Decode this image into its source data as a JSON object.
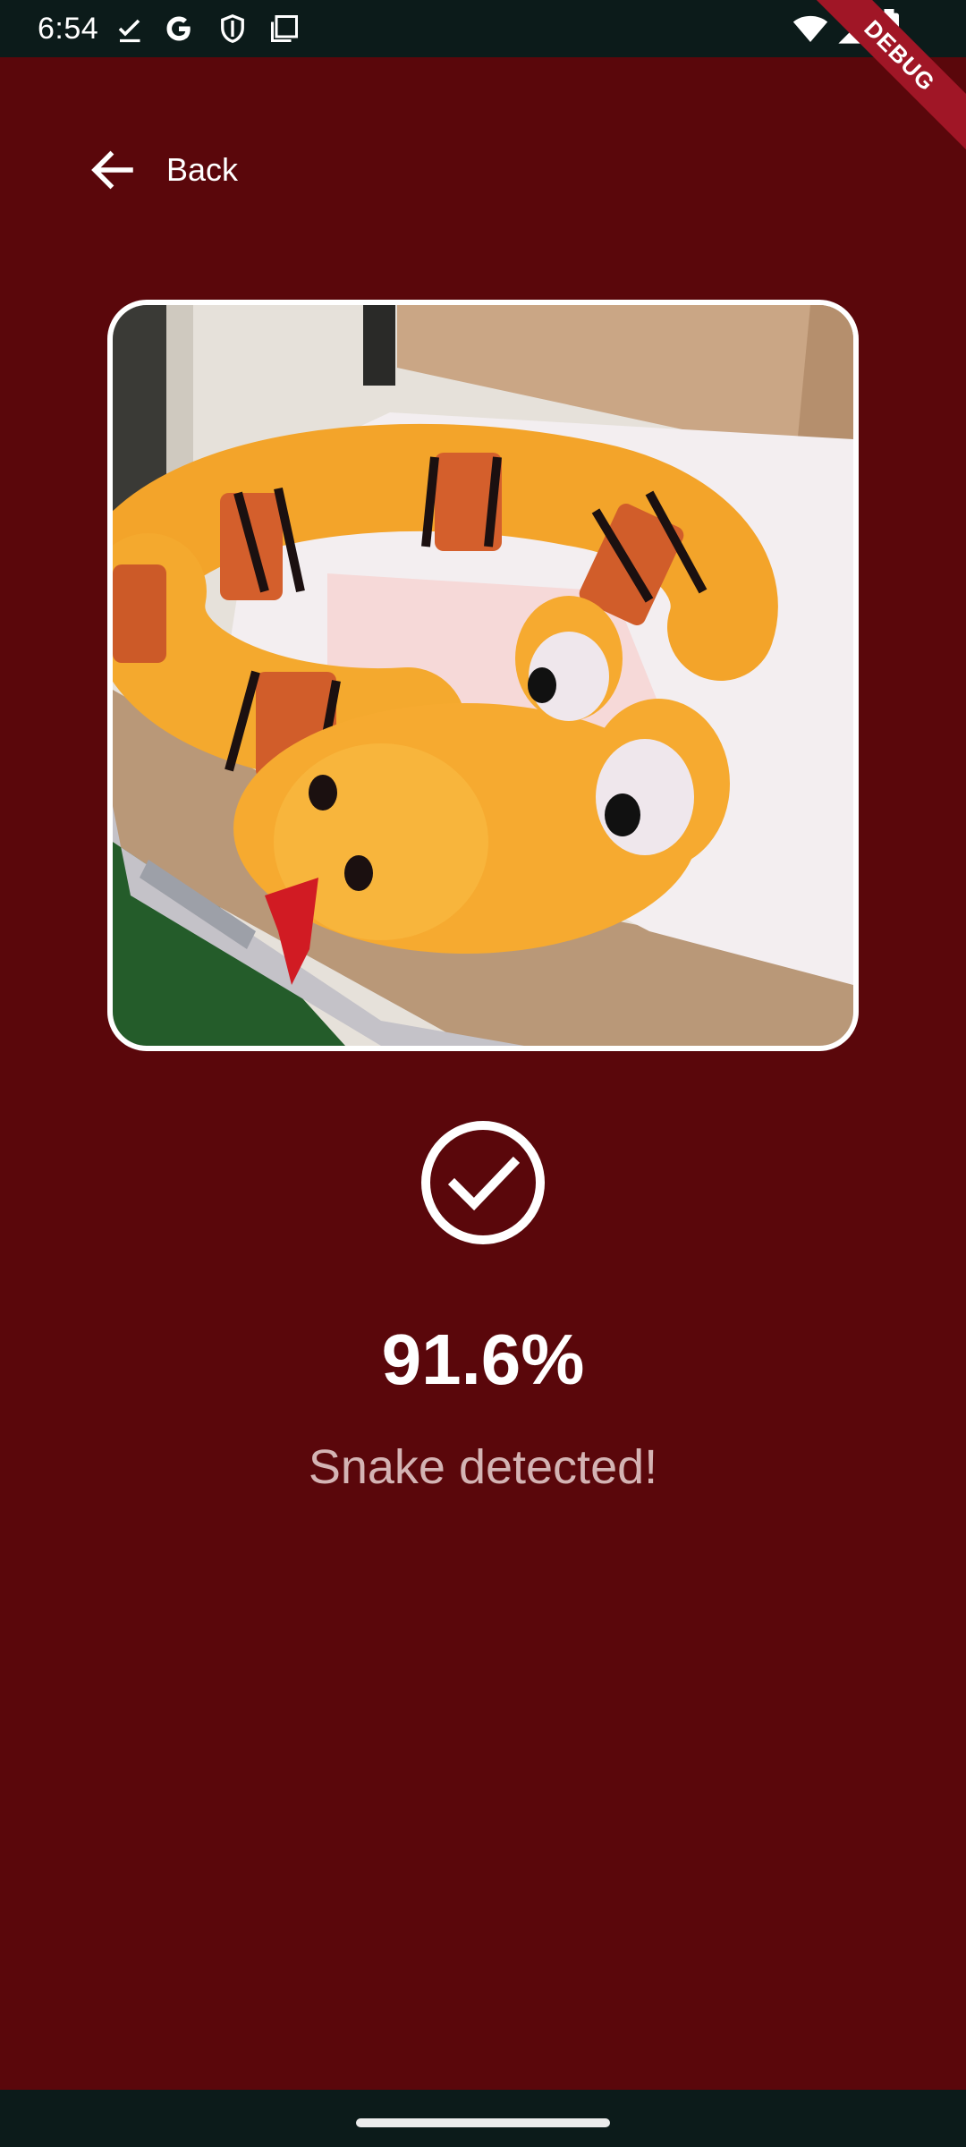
{
  "status_bar": {
    "time": "6:54",
    "left_icons": [
      "check-download-icon",
      "google-icon",
      "shield-icon",
      "screenshot-icon"
    ],
    "right_icons": [
      "wifi-icon",
      "signal-icon",
      "battery-icon"
    ]
  },
  "debug_banner": {
    "label": "DEBUG"
  },
  "header": {
    "back_label": "Back"
  },
  "photo": {
    "subject": "plush snake toy on bed"
  },
  "result": {
    "status_icon": "check-circle-icon",
    "confidence": "91.6%",
    "message": "Snake detected!"
  },
  "colors": {
    "background": "#5a070b",
    "system_bars": "#0c1b1a",
    "text_primary": "#ffffff",
    "text_secondary": "#d4b4b4",
    "ribbon": "#a01626"
  }
}
